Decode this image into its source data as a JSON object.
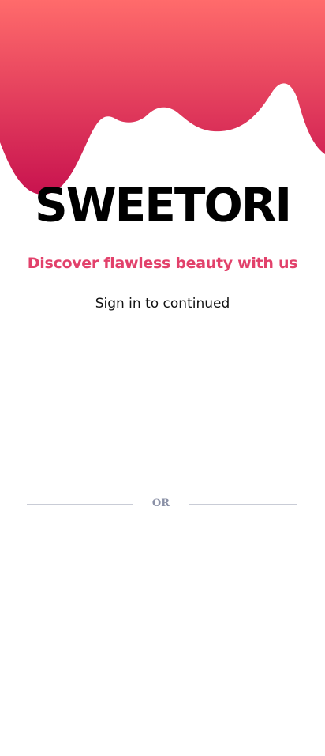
{
  "brand": {
    "name": "SWEETORI"
  },
  "tagline": {
    "text": "Discover flawless beauty with us"
  },
  "subtitle": {
    "text": "Sign in to continued"
  },
  "divider": {
    "label": "OR"
  },
  "colors": {
    "gradient_top": "#ff6b6b",
    "gradient_bottom": "#c8134f",
    "accent": "#e2416b",
    "divider_text": "#8a90a6"
  },
  "icons": {
    "header": "pink-drip-decoration"
  }
}
